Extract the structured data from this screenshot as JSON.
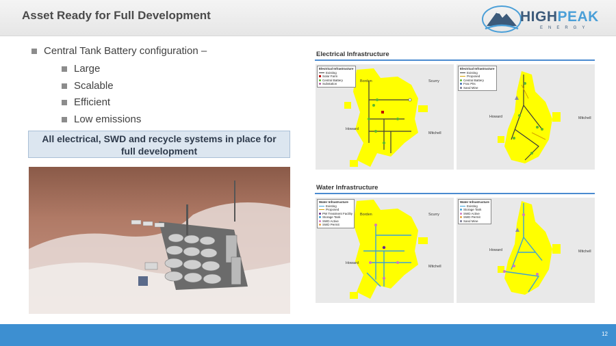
{
  "header": {
    "title": "Asset Ready for Full Development",
    "logo": {
      "brand_high": "HIGH",
      "brand_peak": "PEAK",
      "sub": "ENERGY"
    }
  },
  "bullets": {
    "main": "Central Tank Battery configuration –",
    "sub": [
      "Large",
      "Scalable",
      "Efficient",
      "Low emissions"
    ]
  },
  "callout": {
    "line1": "All electrical, SWD and recycle systems in place for",
    "line2": "full development"
  },
  "electrical": {
    "title": "Electrical Infrastructure",
    "map_left": {
      "legend_title": "Electrical Infrastructure",
      "legend": [
        "Existing",
        "Solar Farm",
        "Central Battery",
        "Substation"
      ],
      "towns": [
        "Borden",
        "Scurry",
        "Howard",
        "Mitchell"
      ]
    },
    "map_right": {
      "legend_title": "Electrical Infrastructure",
      "legend": [
        "Existing",
        "Proposed",
        "Central Battery",
        "Frac Pits",
        "Sand Mine"
      ],
      "towns": [
        "Howard",
        "Mitchell"
      ]
    }
  },
  "water": {
    "title": "Water Infrastructure",
    "map_left": {
      "legend_title": "Water Infrastructure",
      "legend": [
        "Existing",
        "Proposed",
        "PW Treatment Facility",
        "Storage Tank",
        "SWD Active",
        "SWD Permit"
      ],
      "towns": [
        "Borden",
        "Scurry",
        "Howard",
        "Mitchell"
      ]
    },
    "map_right": {
      "legend_title": "Water Infrastructure",
      "legend": [
        "Existing",
        "Storage Tank",
        "SWD Active",
        "SWD Permit",
        "Sand Mine"
      ],
      "towns": [
        "Howard",
        "Mitchell"
      ]
    }
  },
  "colors": {
    "acreage": "#ffff00",
    "accent": "#3d8fd1",
    "existing_line": "#3a3a3a",
    "water_line": "#3aa0d8"
  },
  "footer": {
    "page": "12"
  }
}
